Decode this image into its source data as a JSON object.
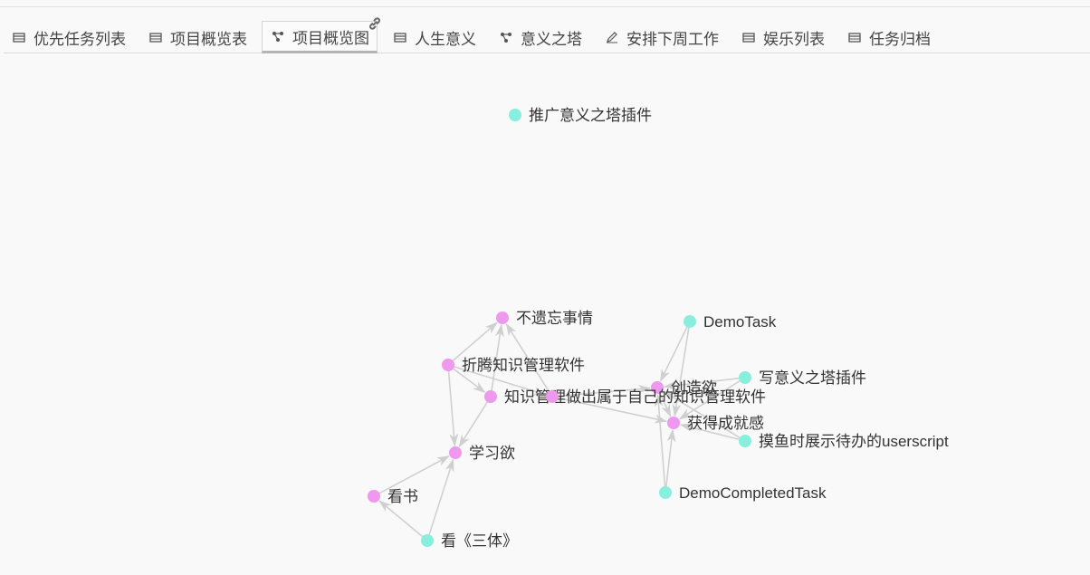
{
  "tabs": [
    {
      "label": "优先任务列表",
      "icon": "table-icon",
      "active": false
    },
    {
      "label": "项目概览表",
      "icon": "table-icon",
      "active": false
    },
    {
      "label": "项目概览图",
      "icon": "graph-icon",
      "active": true
    },
    {
      "label": "人生意义",
      "icon": "table-icon",
      "active": false
    },
    {
      "label": "意义之塔",
      "icon": "graph-icon",
      "active": false
    },
    {
      "label": "安排下周工作",
      "icon": "pencil-icon",
      "active": false
    },
    {
      "label": "娱乐列表",
      "icon": "table-icon",
      "active": false
    },
    {
      "label": "任务归档",
      "icon": "table-icon",
      "active": false
    }
  ],
  "colors": {
    "meaning_node": "#ee99ee",
    "task_node": "#88eedd",
    "edge": "#d0d0d0",
    "label": "#333333"
  },
  "graph": {
    "nodes": [
      {
        "id": "promote",
        "label": "推广意义之塔插件",
        "kind": "task"
      },
      {
        "id": "forget",
        "label": "不遗忘事情",
        "kind": "meaning"
      },
      {
        "id": "demotask",
        "label": "DemoTask",
        "kind": "task"
      },
      {
        "id": "zheteng",
        "label": "折腾知识管理软件",
        "kind": "meaning"
      },
      {
        "id": "write",
        "label": "写意义之塔插件",
        "kind": "task"
      },
      {
        "id": "create",
        "label": "创造欲",
        "kind": "meaning"
      },
      {
        "id": "km",
        "label": "知识管理",
        "kind": "meaning"
      },
      {
        "id": "ownkm",
        "label": "做出属于自己的知识管理软件",
        "kind": "meaning"
      },
      {
        "id": "achieve",
        "label": "获得成就感",
        "kind": "meaning"
      },
      {
        "id": "moyu",
        "label": "摸鱼时展示待办的userscript",
        "kind": "task"
      },
      {
        "id": "learn",
        "label": "学习欲",
        "kind": "meaning"
      },
      {
        "id": "democompleted",
        "label": "DemoCompletedTask",
        "kind": "task"
      },
      {
        "id": "readbook",
        "label": "看书",
        "kind": "meaning"
      },
      {
        "id": "santi",
        "label": "看《三体》",
        "kind": "task"
      }
    ],
    "edges": [
      {
        "source": "zheteng",
        "target": "forget"
      },
      {
        "source": "km",
        "target": "forget"
      },
      {
        "source": "ownkm",
        "target": "forget"
      },
      {
        "source": "zheteng",
        "target": "km"
      },
      {
        "source": "zheteng",
        "target": "learn"
      },
      {
        "source": "zheteng",
        "target": "ownkm"
      },
      {
        "source": "km",
        "target": "learn"
      },
      {
        "source": "ownkm",
        "target": "achieve"
      },
      {
        "source": "ownkm",
        "target": "create"
      },
      {
        "source": "create",
        "target": "achieve"
      },
      {
        "source": "demotask",
        "target": "create"
      },
      {
        "source": "demotask",
        "target": "achieve"
      },
      {
        "source": "write",
        "target": "create"
      },
      {
        "source": "write",
        "target": "achieve"
      },
      {
        "source": "moyu",
        "target": "achieve"
      },
      {
        "source": "moyu",
        "target": "create"
      },
      {
        "source": "democompleted",
        "target": "achieve"
      },
      {
        "source": "democompleted",
        "target": "create"
      },
      {
        "source": "readbook",
        "target": "learn"
      },
      {
        "source": "santi",
        "target": "learn"
      },
      {
        "source": "santi",
        "target": "readbook"
      }
    ]
  }
}
